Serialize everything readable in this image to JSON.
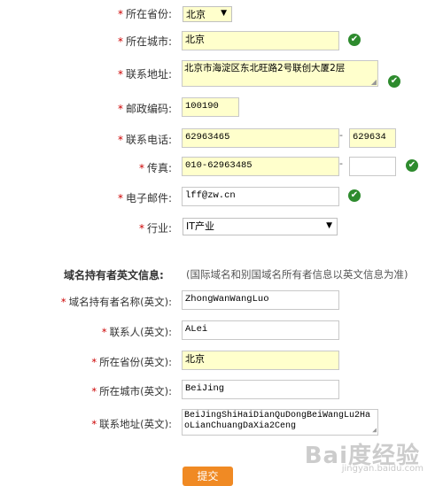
{
  "form": {
    "star": "*",
    "province_label": "所在省份:",
    "province_value": "北京",
    "city_label": "所在城市:",
    "city_value": "北京",
    "address_label": "联系地址:",
    "address_value": "北京市海淀区东北旺路2号联创大厦2层",
    "postcode_label": "邮政编码:",
    "postcode_value": "100190",
    "phone_label": "联系电话:",
    "phone_value": "62963465",
    "phone_ext_value": "629634",
    "fax_label": "传真:",
    "fax_value": "010-62963485",
    "fax_ext_value": "",
    "email_label": "电子邮件:",
    "email_value": "lff@zw.cn",
    "industry_label": "行业:",
    "industry_value": "IT产业",
    "dash": "-",
    "check_icon_glyph": "✔",
    "dropdown_arrow_glyph": "▼",
    "resize_glyph": "◢"
  },
  "english": {
    "section_title": "域名持有者英文信息:",
    "section_note": "(国际域名和别国域名所有者信息以英文信息为准)",
    "owner_name_label": "域名持有者名称(英文):",
    "owner_name_value": "ZhongWanWangLuo",
    "contact_label": "联系人(英文):",
    "contact_value": "ALei",
    "province_label": "所在省份(英文):",
    "province_value": "北京",
    "city_label": "所在城市(英文):",
    "city_value": "BeiJing",
    "address_label": "联系地址(英文):",
    "address_value": "BeiJingShiHaiDianQuDongBeiWangLu2HaoLianChuangDaXia2Ceng"
  },
  "submit_label": "提交",
  "watermark": {
    "logo_text": "Bai度经验",
    "url_text": "jingyan.baidu.com"
  },
  "colors": {
    "required_star": "#cc0000",
    "filled_field_bg": "#ffffcc",
    "valid_check": "#2e8b2e",
    "submit_button": "#f08a24"
  }
}
